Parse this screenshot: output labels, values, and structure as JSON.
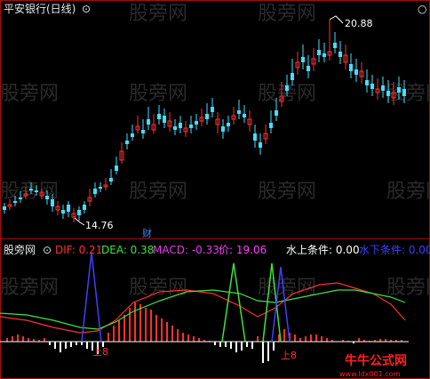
{
  "top_panel": {
    "title": "平安银行(日线)",
    "high_label": "20.88",
    "low_label": "14.76",
    "marker_label": "财"
  },
  "bottom_panel": {
    "indicator_name": "股旁网",
    "dif": "DIF: 0.21",
    "dea": "DEA: 0.38",
    "macd": "MACD: -0.33",
    "price": "价: 19.06",
    "above_water": "水上条件: 0.00",
    "below_water": "水下条件: 0.00",
    "signal_labels": [
      "上8",
      "上8"
    ]
  },
  "watermark": "股旁网",
  "logo_text": "牛牛公式网",
  "logo_url": "www.ldx001.com",
  "colors": {
    "background": "#000000",
    "up": "#ff3030",
    "down": "#40e0ff",
    "dif": "#ff3030",
    "dea": "#40e040",
    "macd": "#e040e0",
    "price": "#ff40ff",
    "above": "#ffffff",
    "below": "#4040ff",
    "grid": "#a01010"
  }
}
